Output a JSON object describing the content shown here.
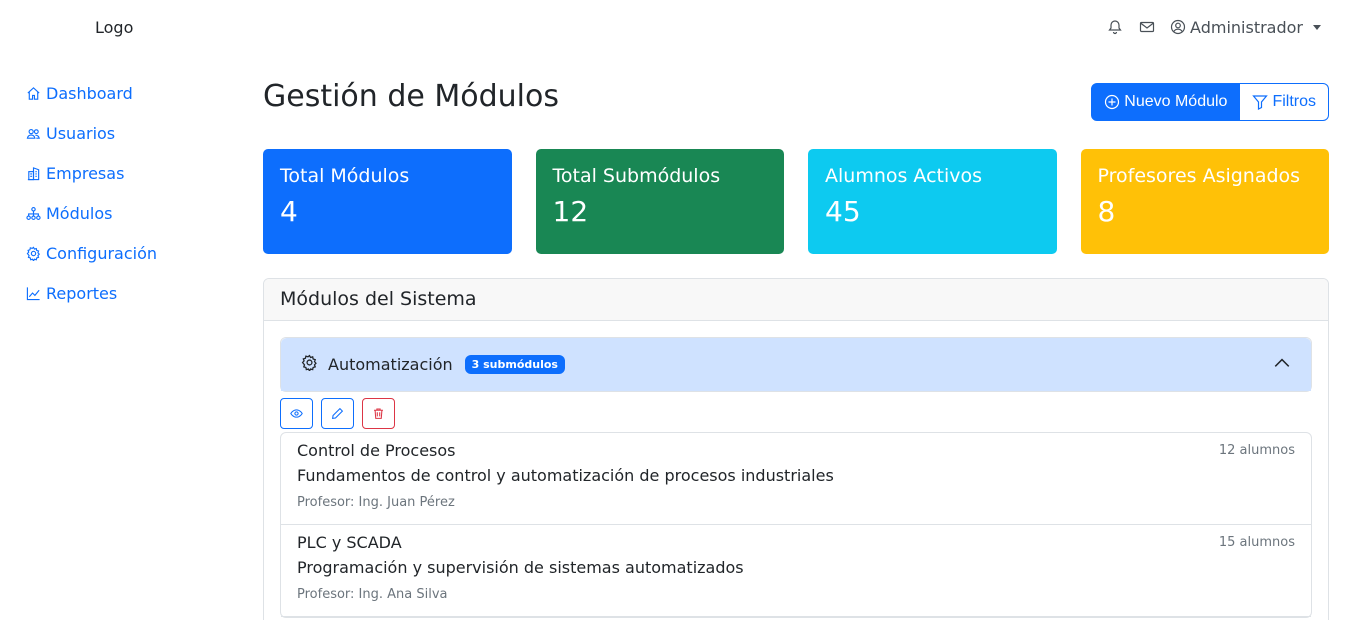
{
  "header": {
    "logo": "Logo",
    "user": "Administrador"
  },
  "sidebar": {
    "items": [
      {
        "label": "Dashboard",
        "icon": "house-icon"
      },
      {
        "label": "Usuarios",
        "icon": "users-icon"
      },
      {
        "label": "Empresas",
        "icon": "building-icon"
      },
      {
        "label": "Módulos",
        "icon": "diagram-icon"
      },
      {
        "label": "Configuración",
        "icon": "gear-icon"
      },
      {
        "label": "Reportes",
        "icon": "graph-icon"
      }
    ]
  },
  "page": {
    "title": "Gestión de Módulos",
    "new_button": "Nuevo Módulo",
    "filters_button": "Filtros"
  },
  "stats": [
    {
      "label": "Total Módulos",
      "value": "4",
      "color": "#0d6efd"
    },
    {
      "label": "Total Submódulos",
      "value": "12",
      "color": "#198754"
    },
    {
      "label": "Alumnos Activos",
      "value": "45",
      "color": "#0dcaf0"
    },
    {
      "label": "Profesores Asignados",
      "value": "8",
      "color": "#ffc107"
    }
  ],
  "modules": {
    "title": "Módulos del Sistema",
    "accordion": {
      "title": "Automatización",
      "badge": "3 submódulos"
    },
    "submodules": [
      {
        "name": "Control de Procesos",
        "description": "Fundamentos de control y automatización de procesos industriales",
        "professor": "Profesor: Ing. Juan Pérez",
        "students": "12 alumnos"
      },
      {
        "name": "PLC y SCADA",
        "description": "Programación y supervisión de sistemas automatizados",
        "professor": "Profesor: Ing. Ana Silva",
        "students": "15 alumnos"
      }
    ]
  },
  "colors": {
    "accent": "#0d6efd",
    "danger": "#dc3545",
    "accordion_bg": "#cfe2ff"
  }
}
